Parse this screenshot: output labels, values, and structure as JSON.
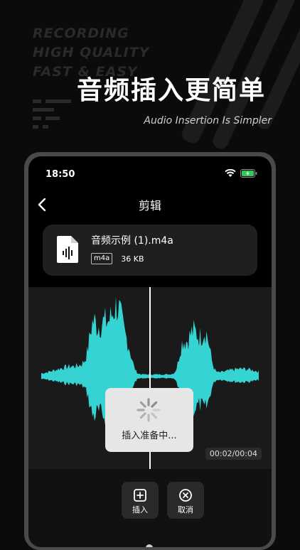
{
  "promo": {
    "deco_lines": [
      "RECORDING",
      "HIGH QUALITY",
      "FAST & EASY"
    ],
    "headline": "音频插入更简单",
    "subline": "Audio Insertion Is Simpler"
  },
  "status": {
    "time": "18:50"
  },
  "nav": {
    "title": "剪辑"
  },
  "file": {
    "name": "音频示例 (1).m4a",
    "format": "m4a",
    "size": "36 KB"
  },
  "waveform": {
    "color": "#36d3d3",
    "playhead_progress": 0.5
  },
  "player": {
    "time": "00:02/00:04"
  },
  "loading": {
    "text": "插入准备中..."
  },
  "actions": [
    {
      "label": "插入",
      "icon": "plus-square-icon"
    },
    {
      "label": "取消",
      "icon": "close-circle-icon"
    }
  ]
}
